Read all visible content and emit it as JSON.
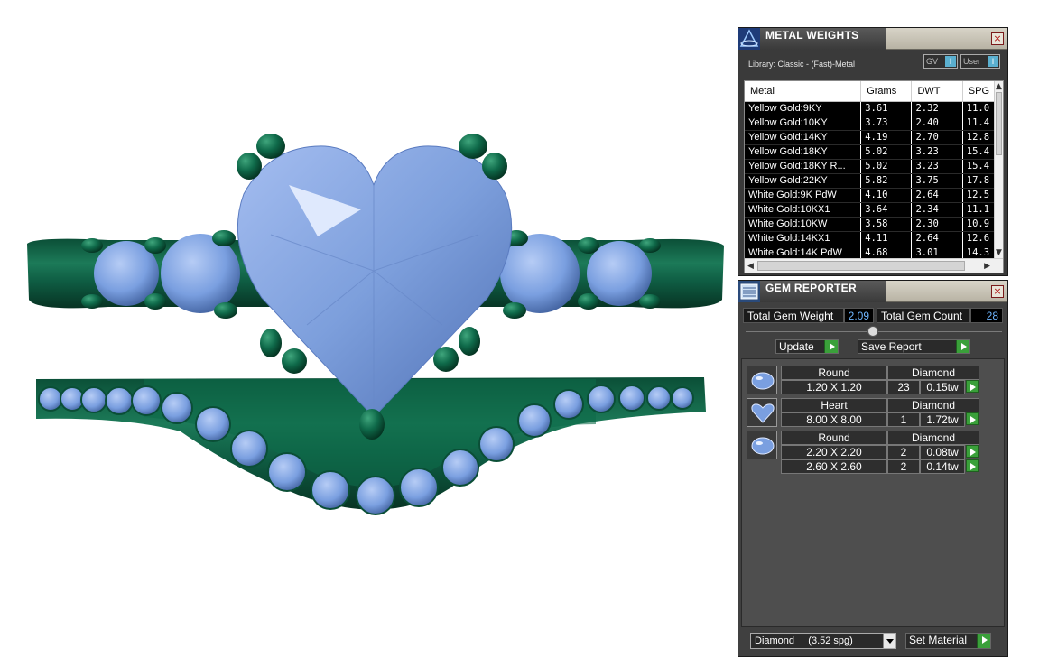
{
  "metal_weights": {
    "title": "METAL WEIGHTS",
    "close_label": "×",
    "library_label": "Library: Classic - (Fast)-Metal",
    "gv_label": "GV",
    "user_label": "User",
    "toggle_indicator": "I",
    "columns": [
      "Metal",
      "Grams",
      "DWT",
      "SPG"
    ],
    "rows": [
      [
        "Yellow Gold:9KY",
        "3.61",
        "2.32",
        "11.0"
      ],
      [
        "Yellow Gold:10KY",
        "3.73",
        "2.40",
        "11.4"
      ],
      [
        "Yellow Gold:14KY",
        "4.19",
        "2.70",
        "12.8"
      ],
      [
        "Yellow Gold:18KY",
        "5.02",
        "3.23",
        "15.4"
      ],
      [
        "Yellow Gold:18KY R...",
        "5.02",
        "3.23",
        "15.4"
      ],
      [
        "Yellow Gold:22KY",
        "5.82",
        "3.75",
        "17.8"
      ],
      [
        "White Gold:9K PdW",
        "4.10",
        "2.64",
        "12.5"
      ],
      [
        "White Gold:10KX1",
        "3.64",
        "2.34",
        "11.1"
      ],
      [
        "White Gold:10KW",
        "3.58",
        "2.30",
        "10.9"
      ],
      [
        "White Gold:14KX1",
        "4.11",
        "2.64",
        "12.6"
      ],
      [
        "White Gold:14K PdW",
        "4.68",
        "3.01",
        "14.3"
      ]
    ]
  },
  "gem_reporter": {
    "title": "GEM REPORTER",
    "close_label": "×",
    "total_weight_label": "Total Gem Weight",
    "total_weight_value": "2.09",
    "total_count_label": "Total Gem Count",
    "total_count_value": "28",
    "update_label": "Update",
    "save_report_label": "Save Report",
    "groups": [
      {
        "shape": "Round",
        "material": "Diamond",
        "entries": [
          {
            "size": "1.20 X 1.20",
            "count": "23",
            "weight": "0.15tw"
          }
        ]
      },
      {
        "shape": "Heart",
        "material": "Diamond",
        "entries": [
          {
            "size": "8.00 X 8.00",
            "count": "1",
            "weight": "1.72tw"
          }
        ]
      },
      {
        "shape": "Round",
        "material": "Diamond",
        "entries": [
          {
            "size": "2.20 X 2.20",
            "count": "2",
            "weight": "0.08tw"
          },
          {
            "size": "2.60 X 2.60",
            "count": "2",
            "weight": "0.14tw"
          }
        ]
      }
    ],
    "material_select": "Diamond     (3.52 spg)",
    "set_material_label": "Set Material"
  },
  "colors": {
    "metal_green": "#0f5e44",
    "gem_blue": "#7a9fe0",
    "panel_bg": "#404040",
    "value_blue": "#6fb6ff",
    "go_green": "#3aa03a"
  }
}
